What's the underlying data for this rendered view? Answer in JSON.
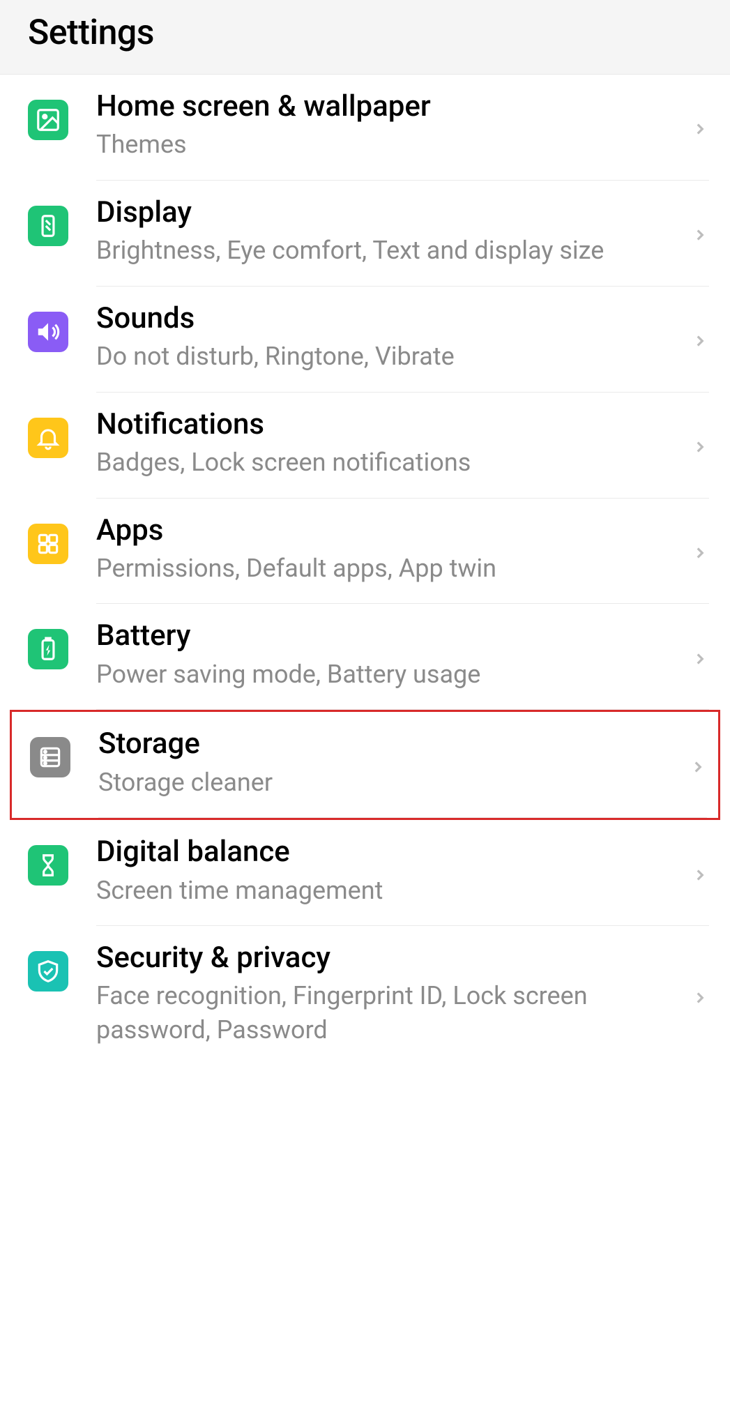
{
  "header": {
    "title": "Settings"
  },
  "items": [
    {
      "title": "Home screen & wallpaper",
      "subtitle": "Themes"
    },
    {
      "title": "Display",
      "subtitle": "Brightness, Eye comfort, Text and display size"
    },
    {
      "title": "Sounds",
      "subtitle": "Do not disturb, Ringtone, Vibrate"
    },
    {
      "title": "Notifications",
      "subtitle": "Badges, Lock screen notifications"
    },
    {
      "title": "Apps",
      "subtitle": "Permissions, Default apps, App twin"
    },
    {
      "title": "Battery",
      "subtitle": "Power saving mode, Battery usage"
    },
    {
      "title": "Storage",
      "subtitle": "Storage cleaner"
    },
    {
      "title": "Digital balance",
      "subtitle": "Screen time management"
    },
    {
      "title": "Security & privacy",
      "subtitle": "Face recognition, Fingerprint ID, Lock screen password, Password"
    }
  ]
}
